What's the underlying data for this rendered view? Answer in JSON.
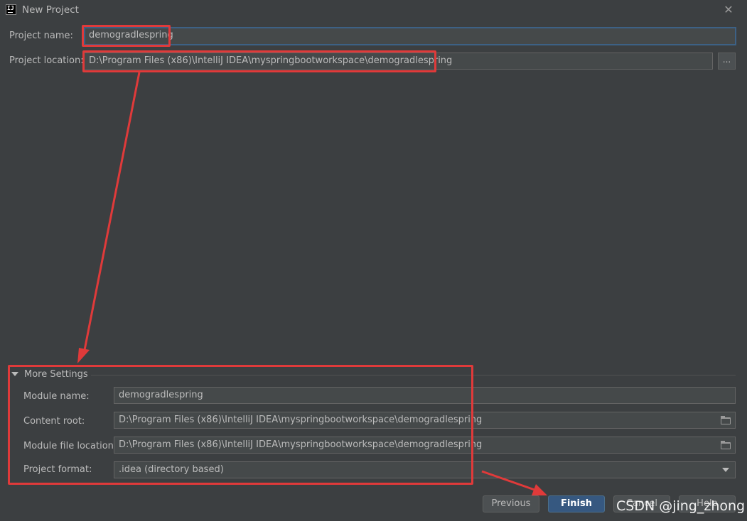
{
  "window": {
    "title": "New Project",
    "close_icon": "close-icon"
  },
  "project": {
    "name_label": "Project name:",
    "name_value": "demogradlespring",
    "location_label": "Project location:",
    "location_value": "D:\\Program Files (x86)\\IntelliJ IDEA\\myspringbootworkspace\\demogradlespring",
    "browse_label": "..."
  },
  "more_settings": {
    "title": "More Settings",
    "module_name_label": "Module name:",
    "module_name_value": "demogradlespring",
    "content_root_label": "Content root:",
    "content_root_value": "D:\\Program Files (x86)\\IntelliJ IDEA\\myspringbootworkspace\\demogradlespring",
    "module_file_label": "Module file location:",
    "module_file_value": "D:\\Program Files (x86)\\IntelliJ IDEA\\myspringbootworkspace\\demogradlespring",
    "format_label": "Project format:",
    "format_value": ".idea (directory based)"
  },
  "buttons": {
    "previous": "Previous",
    "finish": "Finish",
    "cancel": "Cancel",
    "help": "Help"
  },
  "watermark": "CSDN @jing_zhong",
  "colors": {
    "annotation": "#e03a3a",
    "accent": "#365880",
    "background": "#3c3f41"
  }
}
